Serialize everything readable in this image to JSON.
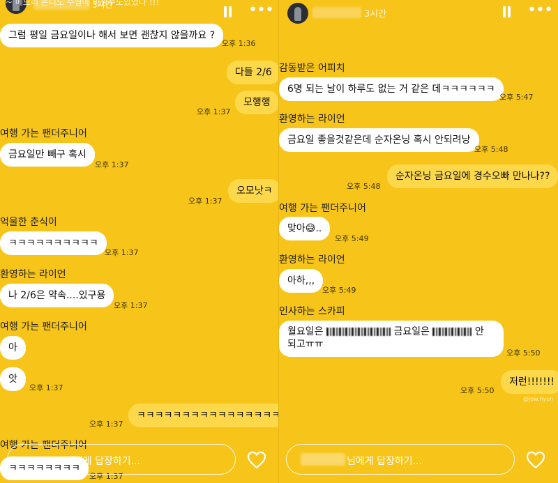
{
  "left": {
    "header_overlay_text": "~ 메모리 온니도 수월에 바뀔수도있었다 !!!",
    "time_ago": "3시간",
    "messages": {
      "m1": "그럼 평일 금요일이나 해서 보면 괜찮지 않을까요 ?",
      "m1_time": "오후 1:36",
      "m2": "다들 2/6",
      "m3": "모행행",
      "m3_time": "오후 1:37",
      "n1": "여행 가는 팬더주니어",
      "m4": "금요일만 빼구 혹시",
      "m4_time": "오후 1:37",
      "m5": "오모낫ㅋ",
      "m5_time": "오후 1:37",
      "n2": "억울한 춘식이",
      "m6": "ㅋㅋㅋㅋㅋㅋㅋㅋㅋㅋ",
      "m6_time": "오후 1:37",
      "n3": "환영하는 라이언",
      "m7": "나 2/6은 약속....있구용",
      "m7_time": "오후 1:37",
      "n4": "여행 가는 팬더주니어",
      "m8": "아",
      "m9": "앗",
      "m9_time": "오후 1:37",
      "m10": "ㅋㅋㅋㅋㅋㅋㅋㅋㅋㅋㅋㅋㅋㅋㅋㅋ",
      "m10_time": "오후 1:37",
      "n5": "여행 가는 팬더주니어",
      "m11": "ㅋㅋㅋㅋㅋㅋㅋㅋ",
      "m11_time": "오후 1:37"
    },
    "reply_placeholder": "님에게 답장하기..."
  },
  "right": {
    "time_ago": "3시간",
    "messages": {
      "n1": "감동받은 어피치",
      "m1": "6명 되는 날이 하루도 없는 거 같은 데ㅋㅋㅋㅋㅋㅋ",
      "m1_time": "오후 5:47",
      "n2": "환영하는 라이언",
      "m2": "금요일 좋을것같은데 순자온닝 혹시 안되려낭",
      "m2_time": "오후 5:48",
      "m3": "순자온닝 금요일에 경수오빠 만나나??",
      "m3_time": "오후 5:48",
      "n3": "여행 가는 팬더주니어",
      "m4": "맞아😅..",
      "m4_time": "오후 5:49",
      "n4": "환영하는 라이언",
      "m5": "아하,,,",
      "m5_time": "오후 5:49",
      "n5": "인사하는 스카피",
      "m6a_pre": "월요일은",
      "m6a_mid": "금요일은",
      "m6a_post": "안",
      "m6b": "되고ㅠㅠ",
      "m6_time": "오후 5:50",
      "m7": "저런!!!!!!!",
      "m7_time": "오후 5:50"
    },
    "reply_placeholder": "님에게 답장하기...",
    "watermark": "@jow.hyun"
  },
  "colors": {
    "background": "#f7c41a",
    "my_bubble": "#fdd84a",
    "other_bubble": "#ffffff"
  },
  "icons": [
    "pause-icon",
    "more-icon",
    "heart-icon"
  ]
}
